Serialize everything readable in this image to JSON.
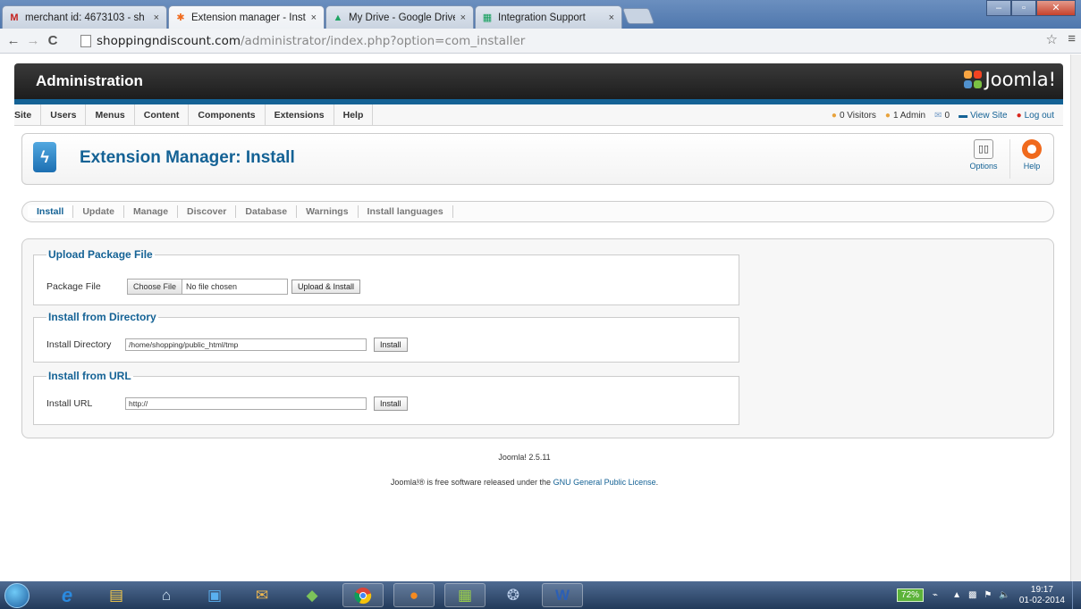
{
  "browser": {
    "tabs": [
      {
        "title": "merchant id: 4673103 - sh",
        "icon": "gmail-icon",
        "active": false
      },
      {
        "title": "Extension manager - Insta",
        "icon": "joomla-icon",
        "active": true
      },
      {
        "title": "My Drive - Google Drive",
        "icon": "google-drive-icon",
        "active": false
      },
      {
        "title": "Integration Support",
        "icon": "sheets-icon",
        "active": false
      }
    ],
    "url_host": "shoppingndiscount.com",
    "url_path": "/administrator/index.php?option=com_installer"
  },
  "header": {
    "title": "Administration",
    "logo_text": "Joomla!"
  },
  "menu": {
    "items": [
      "Site",
      "Users",
      "Menus",
      "Content",
      "Components",
      "Extensions",
      "Help"
    ]
  },
  "status": {
    "visitors": "0 Visitors",
    "admins": "1 Admin",
    "messages": "0",
    "view_site": "View Site",
    "logout": "Log out"
  },
  "toolbar": {
    "title": "Extension Manager: Install",
    "options_label": "Options",
    "help_label": "Help"
  },
  "subnav": {
    "items": [
      "Install",
      "Update",
      "Manage",
      "Discover",
      "Database",
      "Warnings",
      "Install languages"
    ],
    "active": "Install"
  },
  "upload": {
    "legend": "Upload Package File",
    "label": "Package File",
    "choose_label": "Choose File",
    "no_file": "No file chosen",
    "button": "Upload & Install"
  },
  "directory": {
    "legend": "Install from Directory",
    "label": "Install Directory",
    "value": "/home/shopping/public_html/tmp",
    "button": "Install"
  },
  "url_install": {
    "legend": "Install from URL",
    "label": "Install URL",
    "value": "http://",
    "button": "Install"
  },
  "footer": {
    "version": "Joomla! 2.5.11",
    "license_prefix": "Joomla!® is free software released under the ",
    "license_link": "GNU General Public License",
    "license_suffix": "."
  },
  "taskbar": {
    "battery": "72%",
    "time": "19:17",
    "date": "01-02-2014"
  }
}
